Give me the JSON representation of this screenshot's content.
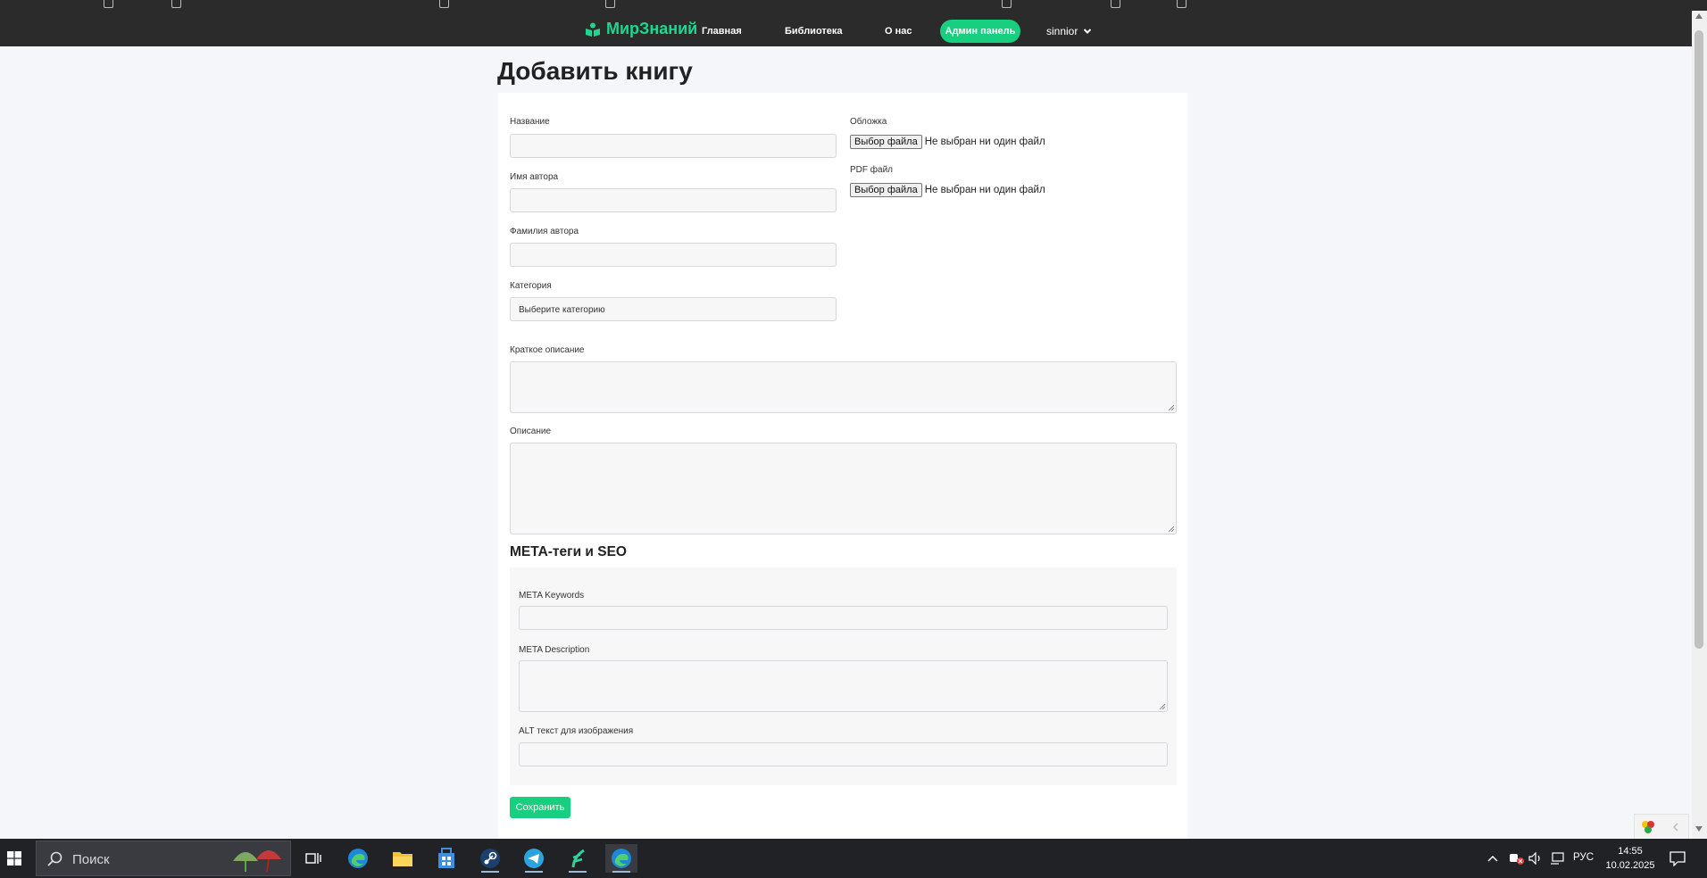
{
  "navbar": {
    "brand": "МирЗнаний",
    "links": [
      "Главная",
      "Библиотека",
      "О нас"
    ],
    "admin_button": "Админ панель",
    "username": "sinnior"
  },
  "page": {
    "title": "Добавить книгу"
  },
  "form": {
    "title_label": "Название",
    "author_first_label": "Имя автора",
    "author_last_label": "Фамилия автора",
    "category_label": "Категория",
    "category_selected": "Выберите категорию",
    "cover_label": "Обложка",
    "pdf_label": "PDF файл",
    "file_button": "Выбор файла",
    "no_file_text": "Не выбран ни один файл",
    "short_description_label": "Краткое описание",
    "description_label": "Описание"
  },
  "seo": {
    "title": "META-теги и SEO",
    "keywords_label": "META Keywords",
    "description_label": "META Description",
    "alt_label": "ALT текст для изображения"
  },
  "actions": {
    "save_label": "Сохранить"
  },
  "taskbar": {
    "search_placeholder": "Поиск",
    "language": "РУС",
    "time": "14:55",
    "date": "10.02.2025",
    "apps": [
      "task-view-icon",
      "edge-icon",
      "file-explorer-icon",
      "store-icon",
      "steam-icon",
      "telegram-icon",
      "app-icon",
      "edge-icon"
    ]
  },
  "colors": {
    "accent": "#17cf7f",
    "brand": "#1ed690",
    "navbar": "#2b2b2b",
    "page_bg": "#f4f6f9"
  }
}
